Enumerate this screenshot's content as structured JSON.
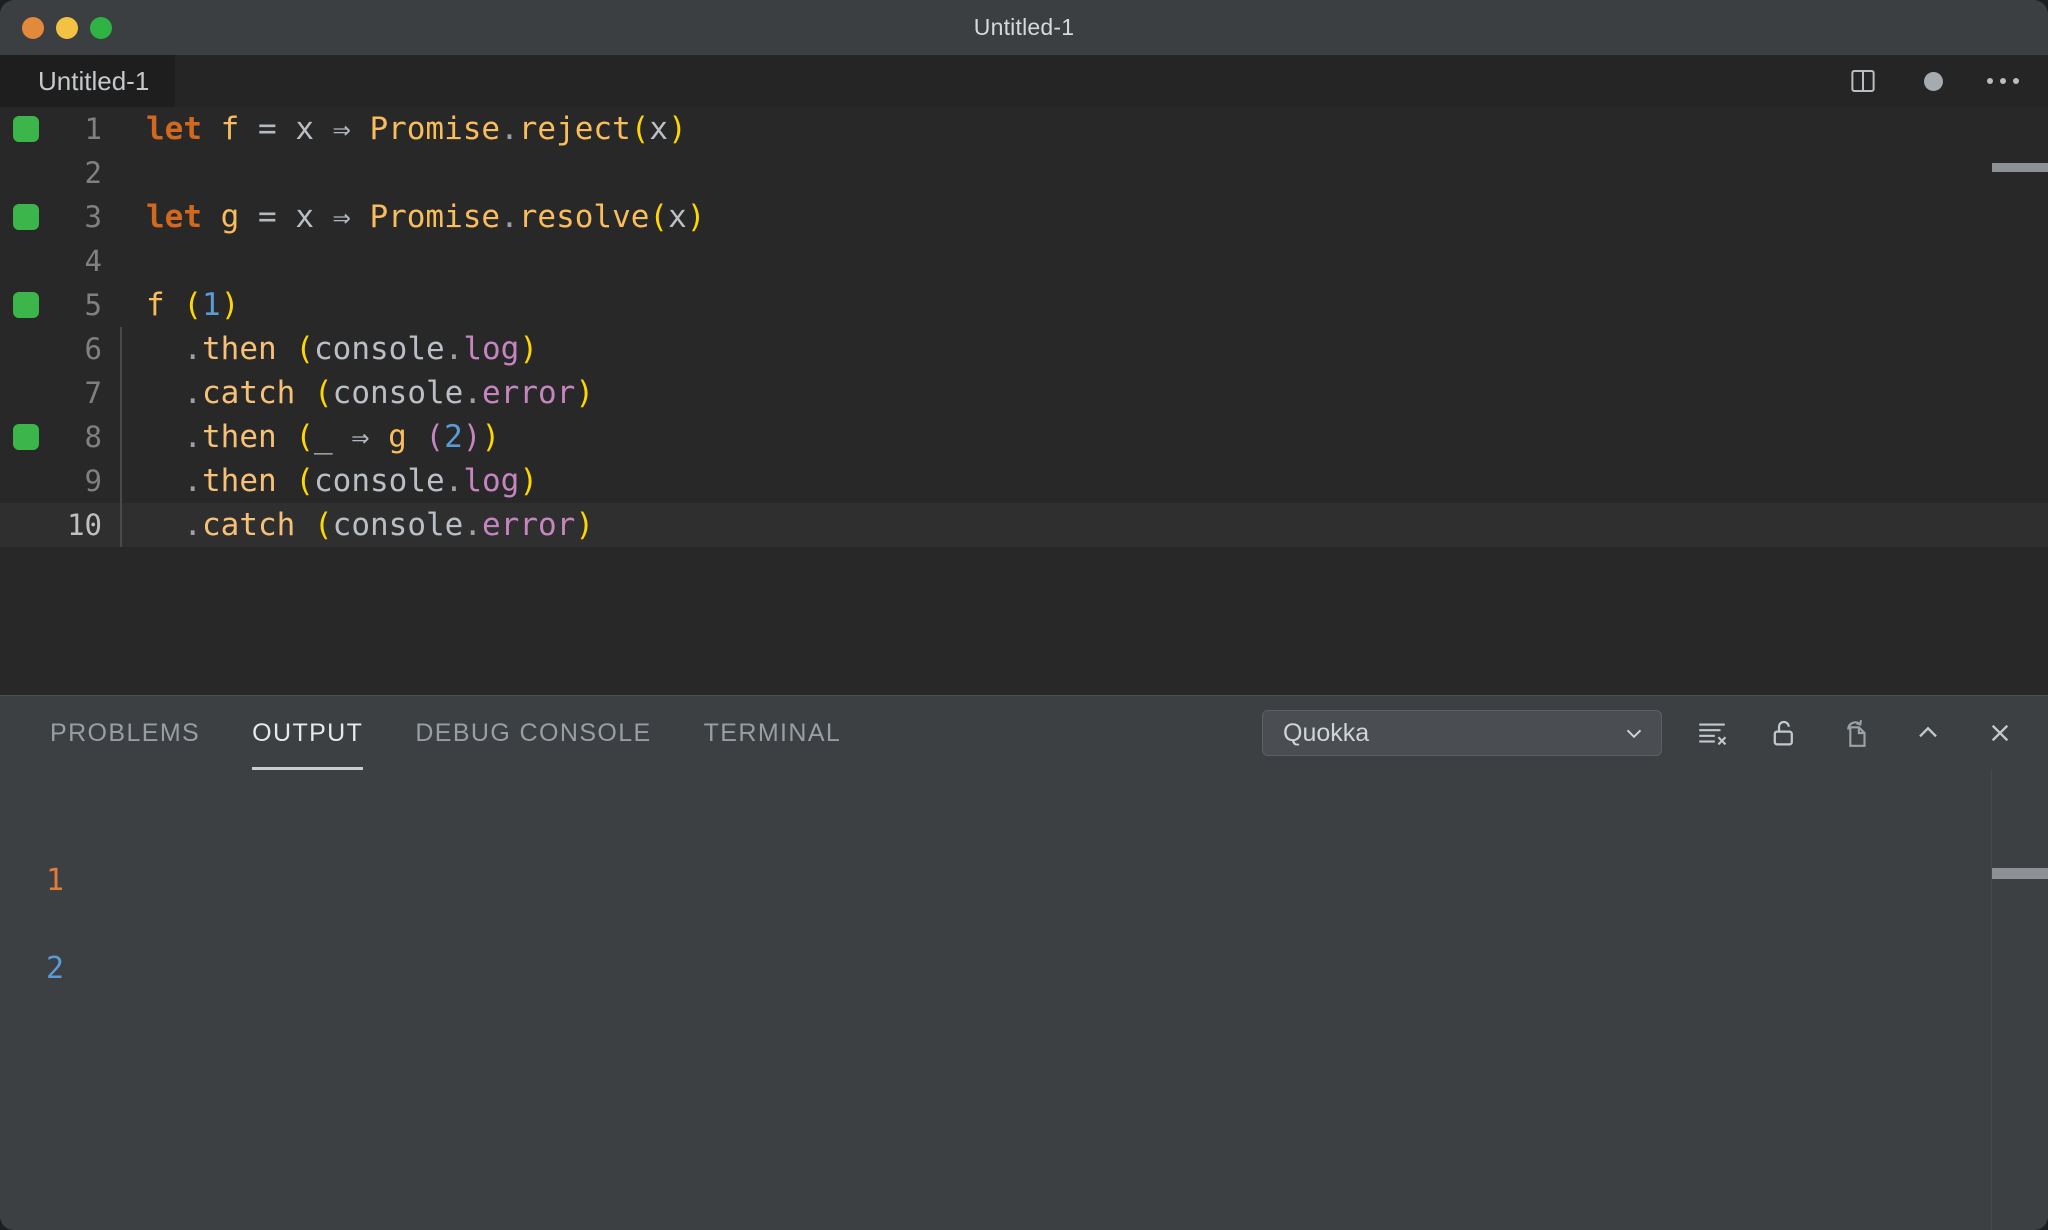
{
  "window": {
    "title": "Untitled-1",
    "traffic_lights": [
      {
        "name": "close",
        "color": "#e2893b"
      },
      {
        "name": "minimize",
        "color": "#f3c242"
      },
      {
        "name": "maximize",
        "color": "#2fb344"
      }
    ]
  },
  "tabbar": {
    "tab_label": "Untitled-1",
    "actions": [
      {
        "name": "split-editor-icon",
        "label": "Split Editor"
      },
      {
        "name": "unsaved-dot",
        "label": "Unsaved changes"
      },
      {
        "name": "more-actions-icon",
        "label": "More Actions..."
      }
    ]
  },
  "editor": {
    "language": "javascript",
    "lines": [
      {
        "number": "1",
        "marker": true,
        "current": false,
        "indent_guide": false,
        "tokens": [
          {
            "t": "let",
            "c": "t-kw"
          },
          {
            "t": " ",
            "c": "t-op"
          },
          {
            "t": "f",
            "c": "t-fn"
          },
          {
            "t": " ",
            "c": "t-op"
          },
          {
            "t": "=",
            "c": "t-op"
          },
          {
            "t": " ",
            "c": "t-op"
          },
          {
            "t": "x",
            "c": "t-ident"
          },
          {
            "t": " ",
            "c": "t-op"
          },
          {
            "t": "⇒",
            "c": "t-arrow"
          },
          {
            "t": " ",
            "c": "t-op"
          },
          {
            "t": "Promise",
            "c": "t-promise"
          },
          {
            "t": ".",
            "c": "t-punc"
          },
          {
            "t": "reject",
            "c": "t-promise"
          },
          {
            "t": "(",
            "c": "t-br1"
          },
          {
            "t": "x",
            "c": "t-ident"
          },
          {
            "t": ")",
            "c": "t-br1"
          }
        ]
      },
      {
        "number": "2",
        "marker": false,
        "current": false,
        "indent_guide": false,
        "tokens": []
      },
      {
        "number": "3",
        "marker": true,
        "current": false,
        "indent_guide": false,
        "tokens": [
          {
            "t": "let",
            "c": "t-kw"
          },
          {
            "t": " ",
            "c": "t-op"
          },
          {
            "t": "g",
            "c": "t-fn"
          },
          {
            "t": " ",
            "c": "t-op"
          },
          {
            "t": "=",
            "c": "t-op"
          },
          {
            "t": " ",
            "c": "t-op"
          },
          {
            "t": "x",
            "c": "t-ident"
          },
          {
            "t": " ",
            "c": "t-op"
          },
          {
            "t": "⇒",
            "c": "t-arrow"
          },
          {
            "t": " ",
            "c": "t-op"
          },
          {
            "t": "Promise",
            "c": "t-promise"
          },
          {
            "t": ".",
            "c": "t-punc"
          },
          {
            "t": "resolve",
            "c": "t-promise"
          },
          {
            "t": "(",
            "c": "t-br1"
          },
          {
            "t": "x",
            "c": "t-ident"
          },
          {
            "t": ")",
            "c": "t-br1"
          }
        ]
      },
      {
        "number": "4",
        "marker": false,
        "current": false,
        "indent_guide": false,
        "tokens": []
      },
      {
        "number": "5",
        "marker": true,
        "current": false,
        "indent_guide": false,
        "tokens": [
          {
            "t": "f",
            "c": "t-fn"
          },
          {
            "t": " ",
            "c": "t-op"
          },
          {
            "t": "(",
            "c": "t-br1"
          },
          {
            "t": "1",
            "c": "t-num"
          },
          {
            "t": ")",
            "c": "t-br1"
          }
        ]
      },
      {
        "number": "6",
        "marker": false,
        "current": false,
        "indent_guide": true,
        "tokens": [
          {
            "t": "  ",
            "c": "t-op"
          },
          {
            "t": ".",
            "c": "t-punc"
          },
          {
            "t": "then",
            "c": "t-prop"
          },
          {
            "t": " ",
            "c": "t-op"
          },
          {
            "t": "(",
            "c": "t-br1"
          },
          {
            "t": "console",
            "c": "t-ident"
          },
          {
            "t": ".",
            "c": "t-punc"
          },
          {
            "t": "log",
            "c": "t-member"
          },
          {
            "t": ")",
            "c": "t-br1"
          }
        ]
      },
      {
        "number": "7",
        "marker": false,
        "current": false,
        "indent_guide": true,
        "tokens": [
          {
            "t": "  ",
            "c": "t-op"
          },
          {
            "t": ".",
            "c": "t-punc"
          },
          {
            "t": "catch",
            "c": "t-prop"
          },
          {
            "t": " ",
            "c": "t-op"
          },
          {
            "t": "(",
            "c": "t-br1"
          },
          {
            "t": "console",
            "c": "t-ident"
          },
          {
            "t": ".",
            "c": "t-punc"
          },
          {
            "t": "error",
            "c": "t-member"
          },
          {
            "t": ")",
            "c": "t-br1"
          }
        ]
      },
      {
        "number": "8",
        "marker": true,
        "current": false,
        "indent_guide": true,
        "tokens": [
          {
            "t": "  ",
            "c": "t-op"
          },
          {
            "t": ".",
            "c": "t-punc"
          },
          {
            "t": "then",
            "c": "t-prop"
          },
          {
            "t": " ",
            "c": "t-op"
          },
          {
            "t": "(",
            "c": "t-br1"
          },
          {
            "t": "_",
            "c": "t-ident"
          },
          {
            "t": " ",
            "c": "t-op"
          },
          {
            "t": "⇒",
            "c": "t-arrow"
          },
          {
            "t": " ",
            "c": "t-op"
          },
          {
            "t": "g",
            "c": "t-fn"
          },
          {
            "t": " ",
            "c": "t-op"
          },
          {
            "t": "(",
            "c": "t-br2"
          },
          {
            "t": "2",
            "c": "t-num"
          },
          {
            "t": ")",
            "c": "t-br2"
          },
          {
            "t": ")",
            "c": "t-br1"
          }
        ]
      },
      {
        "number": "9",
        "marker": false,
        "current": false,
        "indent_guide": true,
        "tokens": [
          {
            "t": "  ",
            "c": "t-op"
          },
          {
            "t": ".",
            "c": "t-punc"
          },
          {
            "t": "then",
            "c": "t-prop"
          },
          {
            "t": " ",
            "c": "t-op"
          },
          {
            "t": "(",
            "c": "t-br1"
          },
          {
            "t": "console",
            "c": "t-ident"
          },
          {
            "t": ".",
            "c": "t-punc"
          },
          {
            "t": "log",
            "c": "t-member"
          },
          {
            "t": ")",
            "c": "t-br1"
          }
        ]
      },
      {
        "number": "10",
        "marker": false,
        "current": true,
        "indent_guide": true,
        "tokens": [
          {
            "t": "  ",
            "c": "t-op"
          },
          {
            "t": ".",
            "c": "t-punc"
          },
          {
            "t": "catch",
            "c": "t-prop"
          },
          {
            "t": " ",
            "c": "t-op"
          },
          {
            "t": "(",
            "c": "t-br1"
          },
          {
            "t": "console",
            "c": "t-ident"
          },
          {
            "t": ".",
            "c": "t-punc"
          },
          {
            "t": "error",
            "c": "t-member"
          },
          {
            "t": ")",
            "c": "t-br1"
          }
        ]
      }
    ]
  },
  "panel": {
    "tabs": [
      {
        "label": "PROBLEMS",
        "active": false
      },
      {
        "label": "OUTPUT",
        "active": true
      },
      {
        "label": "DEBUG CONSOLE",
        "active": false
      },
      {
        "label": "TERMINAL",
        "active": false
      }
    ],
    "channel": {
      "selected": "Quokka",
      "options": [
        "Quokka"
      ]
    },
    "actions": [
      {
        "name": "clear-output-icon",
        "label": "Clear Output"
      },
      {
        "name": "unlock-scroll-icon",
        "label": "Turn Auto Scrolling Off"
      },
      {
        "name": "open-in-editor-icon",
        "label": "Open Output in Editor"
      },
      {
        "name": "maximize-panel-icon",
        "label": "Maximize Panel Size"
      },
      {
        "name": "close-panel-icon",
        "label": "Close Panel"
      }
    ],
    "output_lines": [
      {
        "text": "1",
        "color_class": "out-1"
      },
      {
        "text": "2",
        "color_class": "out-2"
      }
    ]
  },
  "colors": {
    "editor_bg": "#282828",
    "panel_bg": "#3c4043",
    "titlebar_bg": "#3c3f41",
    "marker_green": "#3cb54a",
    "accent_underline": "#c8cdd1",
    "output_error": "#e07b39",
    "output_value": "#5b9bd5"
  }
}
